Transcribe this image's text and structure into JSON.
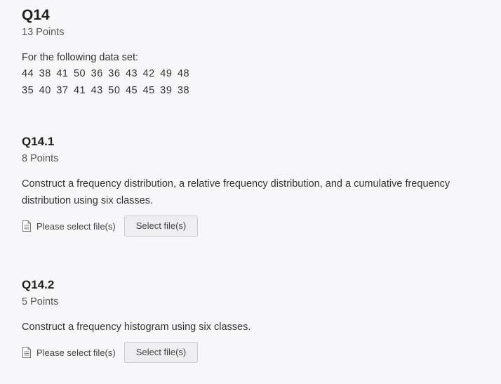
{
  "q14": {
    "title": "Q14",
    "points": "13 Points",
    "intro": "For the following data set:",
    "data_row_1": "44  38  41  50  36  36  43  42  49  48",
    "data_row_2": "35  40  37  41  43  50  45  45  39  38"
  },
  "q14_1": {
    "title": "Q14.1",
    "points": "8 Points",
    "prompt_line_1": "Construct a frequency distribution, a relative frequency distribution, and a cumulative frequency",
    "prompt_line_2": "distribution using six classes.",
    "file_placeholder": "Please select file(s)",
    "select_button": "Select file(s)"
  },
  "q14_2": {
    "title": "Q14.2",
    "points": "5 Points",
    "prompt": "Construct a frequency histogram using six classes.",
    "file_placeholder": "Please select file(s)",
    "select_button": "Select file(s)"
  },
  "icons": {
    "file": "document-icon"
  }
}
